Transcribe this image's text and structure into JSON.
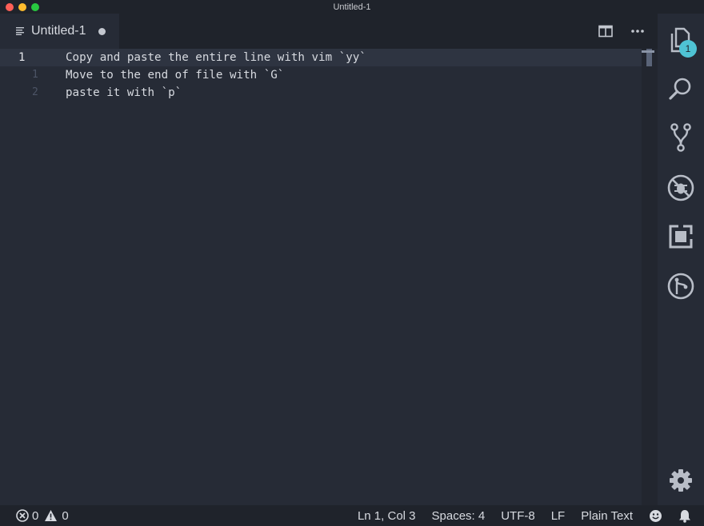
{
  "window": {
    "title": "Untitled-1"
  },
  "tab": {
    "label": "Untitled-1",
    "dirty": true
  },
  "editor": {
    "lines": [
      {
        "number": "1",
        "text": "Copy and paste the entire line with vim `yy`"
      },
      {
        "number": "1",
        "text": "Move to the end of file with `G`"
      },
      {
        "number": "2",
        "text": "paste it with `p`"
      }
    ]
  },
  "activity": {
    "explorer_badge": "1"
  },
  "status": {
    "errors": "0",
    "warnings": "0",
    "position": "Ln 1, Col 3",
    "spaces": "Spaces: 4",
    "encoding": "UTF-8",
    "eol": "LF",
    "language": "Plain Text"
  },
  "icons": [
    "close-icon",
    "minimize-icon",
    "maximize-icon",
    "file-lines-icon",
    "split-editor-icon",
    "more-icon",
    "explorer-icon",
    "search-icon",
    "source-control-icon",
    "debug-icon",
    "extensions-icon",
    "remote-icon",
    "gear-icon",
    "error-icon",
    "warning-icon",
    "smiley-icon",
    "bell-icon"
  ],
  "colors": {
    "background": "#262b36",
    "chrome": "#1f232b",
    "badge": "#4fc3d4"
  }
}
